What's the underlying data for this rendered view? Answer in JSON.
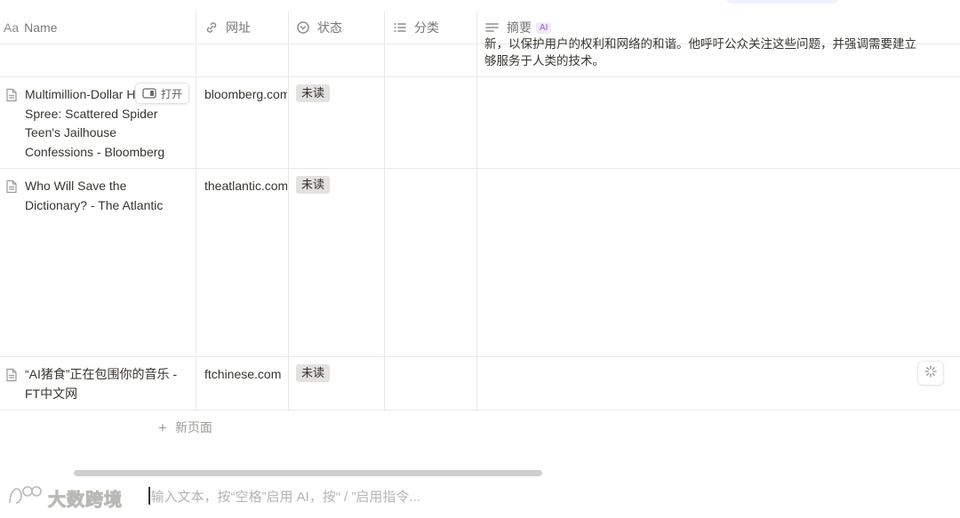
{
  "columns": {
    "name": "Name",
    "url": "网址",
    "status": "状态",
    "category": "分类",
    "summary": "摘要",
    "summary_badge": "AI"
  },
  "top_row": {
    "summary_line1": "新，以保护用户的权利和网络的和谐。他呼吁公众关注这些问题，并强调需要建立",
    "summary_line2": "够服务于人类的技术。"
  },
  "rows": [
    {
      "title": "Multimillion-Dollar Hacking Spree: Scattered Spider Teen's Jailhouse Confessions - Bloomberg",
      "url": "bloomberg.com",
      "status": "未读"
    },
    {
      "title": "Who Will Save the Dictionary? - The Atlantic",
      "url": "theatlantic.com",
      "status": "未读"
    },
    {
      "title": "“AI猪食”正在包围你的音乐 - FT中文网",
      "url": "ftchinese.com",
      "status": "未读"
    }
  ],
  "open_button": "打开",
  "new_page": "新页面",
  "editor_placeholder": "输入文本，按“空格”启用 AI，按“ / ”启用指令...",
  "watermark": "大数跨境",
  "icons": {
    "name_column": "text-aa-icon",
    "url_column": "link-icon",
    "status_column": "status-circle-icon",
    "category_column": "list-icon",
    "summary_column": "text-lines-icon",
    "row": "document-icon",
    "open": "side-peek-icon",
    "sparkle": "ai-sparkle-icon"
  },
  "colors": {
    "status_tag_bg": "#e3e2e0",
    "ai_badge": "#9d5bd2"
  }
}
